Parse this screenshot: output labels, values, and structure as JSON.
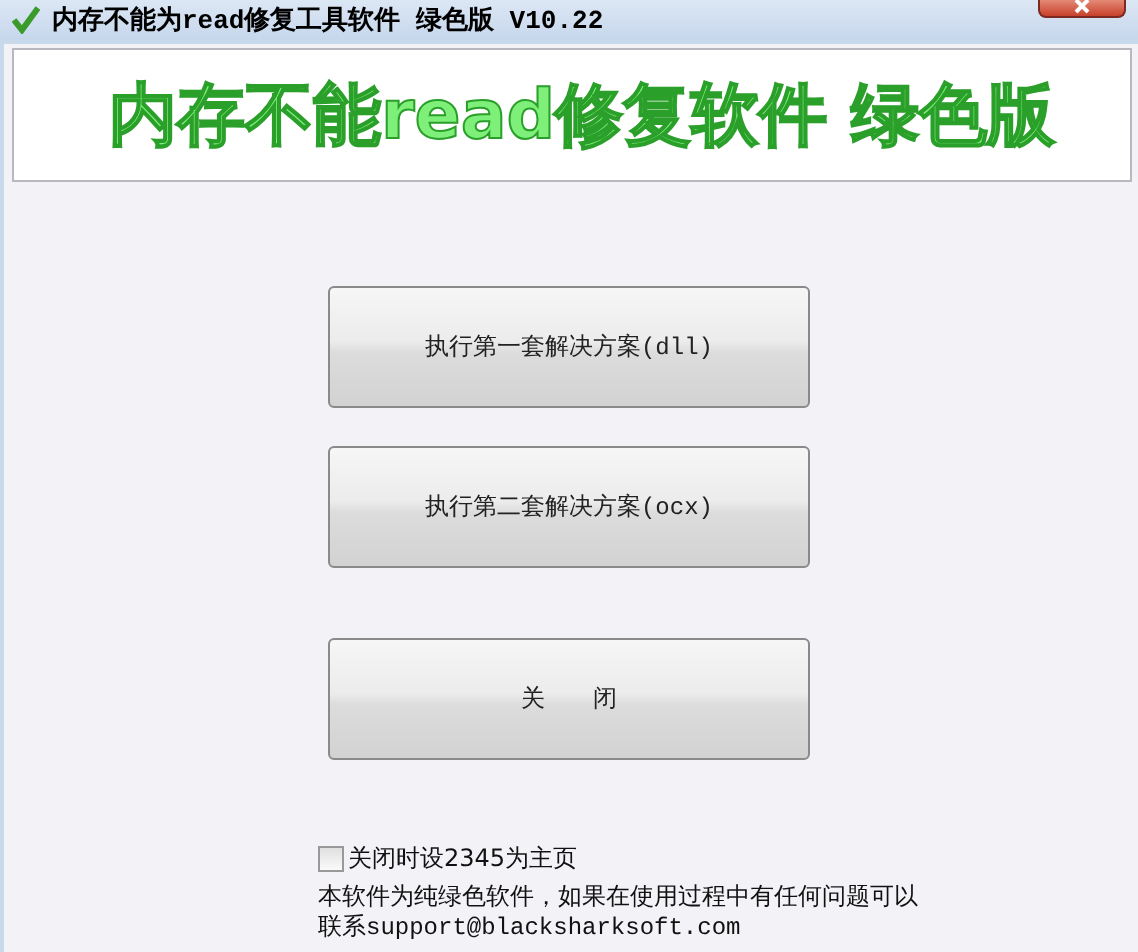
{
  "window": {
    "title": "内存不能为read修复工具软件 绿色版 V10.22"
  },
  "banner": {
    "text": "内存不能read修复软件 绿色版"
  },
  "buttons": [
    {
      "label": "执行第一套解决方案(dll)"
    },
    {
      "label": "执行第二套解决方案(ocx)"
    },
    {
      "label": "关　　闭"
    }
  ],
  "homepage_option": {
    "label": "关闭时设2345为主页",
    "checked": false
  },
  "notice": "本软件为纯绿色软件，如果在使用过程中有任何问题可以联系support@blacksharksoft.com"
}
